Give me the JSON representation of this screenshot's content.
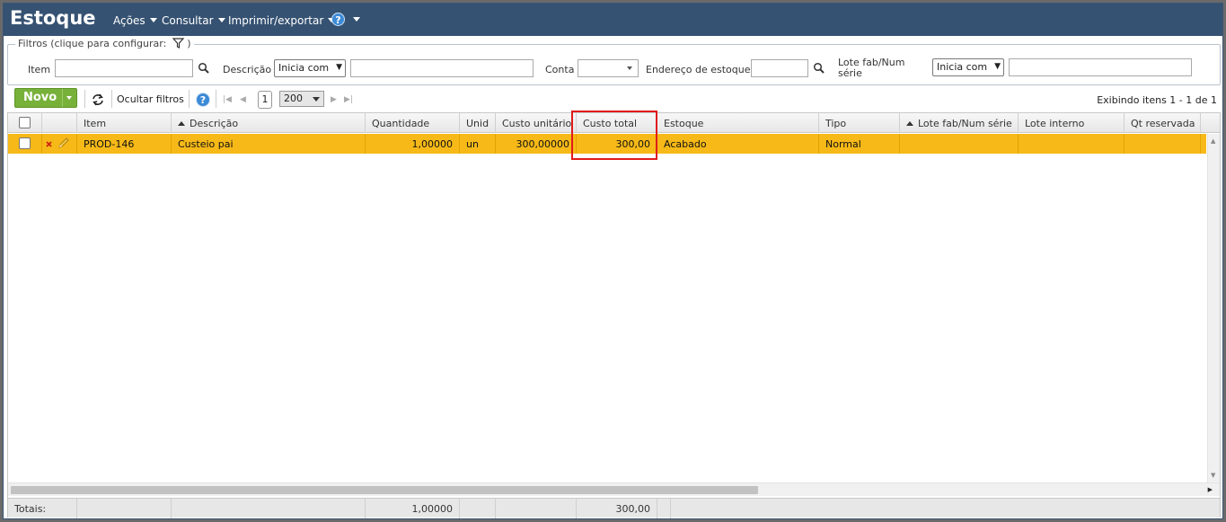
{
  "app": {
    "title": "Estoque"
  },
  "menu": {
    "actions": "Ações",
    "consult": "Consultar",
    "print_export": "Imprimir/exportar",
    "help": "?"
  },
  "filters": {
    "legend": "Filtros (clique para configurar:",
    "legend_close": ")",
    "item_label": "Item",
    "item_value": "",
    "description_label": "Descrição",
    "description_mode": "Inicia com",
    "description_value": "",
    "account_label": "Conta",
    "account_value": "",
    "address_label": "Endereço de estoque",
    "address_value": "",
    "lot_label": "Lote fab/Num série",
    "lot_mode": "Inicia com",
    "lot_value": ""
  },
  "toolbar": {
    "new_label": "Novo",
    "hide_filters": "Ocultar filtros",
    "help": "?",
    "page": "1",
    "page_size": "200",
    "showing": "Exibindo itens 1 - 1 de 1"
  },
  "grid": {
    "columns": [
      "Item",
      "Descrição",
      "Quantidade",
      "Unid",
      "Custo unitário",
      "Custo total",
      "Estoque",
      "Tipo",
      "Lote fab/Num série",
      "Lote interno",
      "Qt reservada"
    ],
    "rows": [
      {
        "item": "PROD-146",
        "description": "Custeio pai",
        "quantity": "1,00000",
        "unit": "un",
        "unit_cost": "300,00000",
        "total_cost": "300,00",
        "stock": "Acabado",
        "type": "Normal",
        "lot": "",
        "internal_lot": "",
        "reserved": ""
      }
    ],
    "totals": {
      "label": "Totais:",
      "quantity": "1,00000",
      "total_cost": "300,00"
    }
  },
  "colors": {
    "header_bg": "#365272",
    "selected_row": "#f6b918",
    "new_button": "#78b13a",
    "highlight_box": "#e01b1b"
  }
}
